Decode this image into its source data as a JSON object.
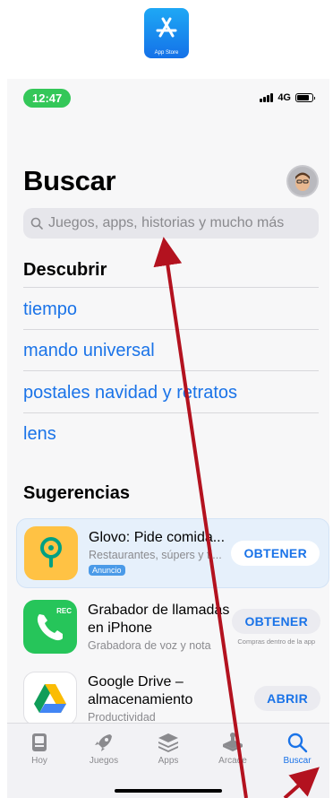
{
  "app_icon": {
    "label": "App Store"
  },
  "status_bar": {
    "time": "12:47",
    "network": "4G"
  },
  "header": {
    "title": "Buscar",
    "avatar": "memoji-avatar"
  },
  "search": {
    "placeholder": "Juegos, apps, historias y mucho más"
  },
  "discover": {
    "heading": "Descubrir",
    "items": [
      {
        "label": "tiempo"
      },
      {
        "label": "mando universal"
      },
      {
        "label": "postales navidad y retratos"
      },
      {
        "label": "lens"
      }
    ]
  },
  "suggestions": {
    "heading": "Sugerencias",
    "items": [
      {
        "title": "Glovo: Pide comida...",
        "subtitle": "Restaurantes, súpers y ti...",
        "badge": "Anuncio",
        "button": "OBTENER",
        "note": ""
      },
      {
        "title": "Grabador de llamadas en iPhone",
        "subtitle": "Grabadora de voz y nota",
        "badge": "",
        "button": "OBTENER",
        "note": "Compras dentro de la app"
      },
      {
        "title": "Google Drive – almacenamiento",
        "subtitle": "Productividad",
        "badge": "",
        "button": "ABRIR",
        "note": ""
      }
    ]
  },
  "tabs": [
    {
      "label": "Hoy",
      "icon": "today-icon",
      "active": false
    },
    {
      "label": "Juegos",
      "icon": "rocket-icon",
      "active": false
    },
    {
      "label": "Apps",
      "icon": "layers-icon",
      "active": false
    },
    {
      "label": "Arcade",
      "icon": "arcade-icon",
      "active": false
    },
    {
      "label": "Buscar",
      "icon": "search-icon",
      "active": true
    }
  ],
  "colors": {
    "accent": "#1a73e8",
    "time_pill": "#34c759",
    "arrow": "#b3121f"
  }
}
